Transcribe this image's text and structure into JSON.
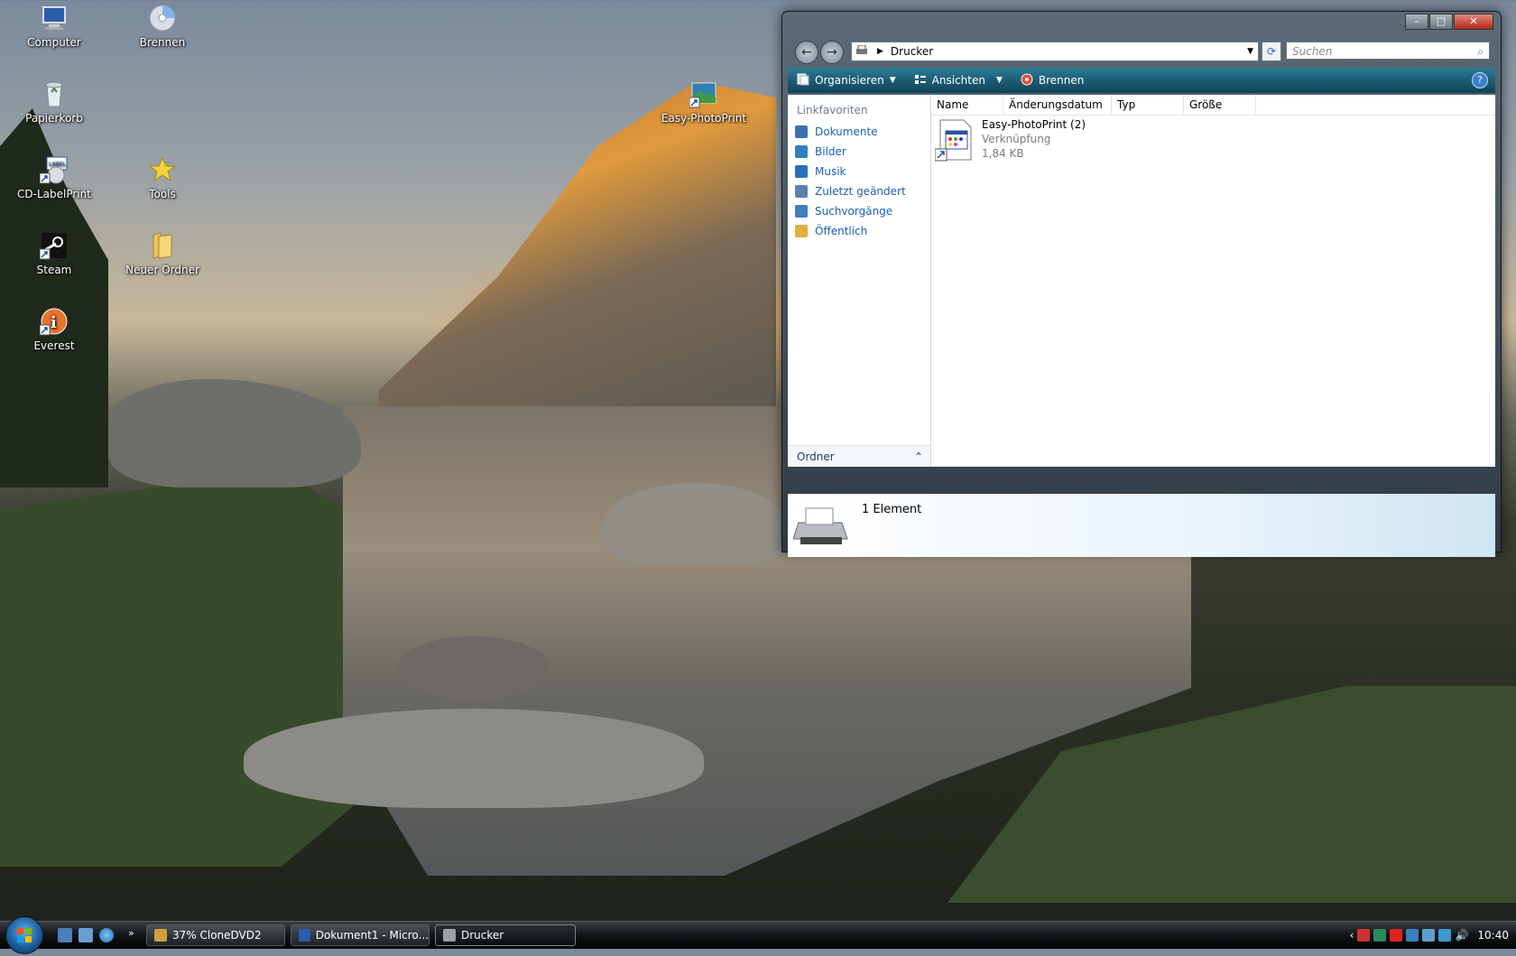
{
  "desktop": {
    "icons": [
      {
        "label": "Computer"
      },
      {
        "label": "Brennen"
      },
      {
        "label": "Papierkorb"
      },
      {
        "label": "Easy-PhotoPrint"
      },
      {
        "label": "CD-LabelPrint"
      },
      {
        "label": "Tools"
      },
      {
        "label": "Steam"
      },
      {
        "label": "Neuer Ordner"
      },
      {
        "label": "Everest"
      }
    ]
  },
  "window": {
    "address": "Drucker",
    "search_placeholder": "Suchen",
    "toolbar": {
      "organize": "Organisieren",
      "views": "Ansichten",
      "burn": "Brennen"
    },
    "sidebar": {
      "title": "Linkfavoriten",
      "items": [
        {
          "label": "Dokumente",
          "color": "#3f6fb0"
        },
        {
          "label": "Bilder",
          "color": "#2f7fc0"
        },
        {
          "label": "Musik",
          "color": "#2a6fb8"
        },
        {
          "label": "Zuletzt geändert",
          "color": "#5b7fb0"
        },
        {
          "label": "Suchvorgänge",
          "color": "#3f7fc0"
        },
        {
          "label": "Öffentlich",
          "color": "#e0b040"
        }
      ],
      "folders_label": "Ordner"
    },
    "columns": [
      "Name",
      "Änderungsdatum",
      "Typ",
      "Größe"
    ],
    "files": [
      {
        "name": "Easy-PhotoPrint (2)",
        "type": "Verknüpfung",
        "size": "1,84 KB"
      }
    ],
    "status": "1 Element"
  },
  "taskbar": {
    "buttons": [
      {
        "label": "37% CloneDVD2"
      },
      {
        "label": "Dokument1 - Micro..."
      },
      {
        "label": "Drucker"
      }
    ],
    "clock": "10:40"
  },
  "colors": {
    "accent": "#1c5d74",
    "link": "#1a5fb4"
  }
}
